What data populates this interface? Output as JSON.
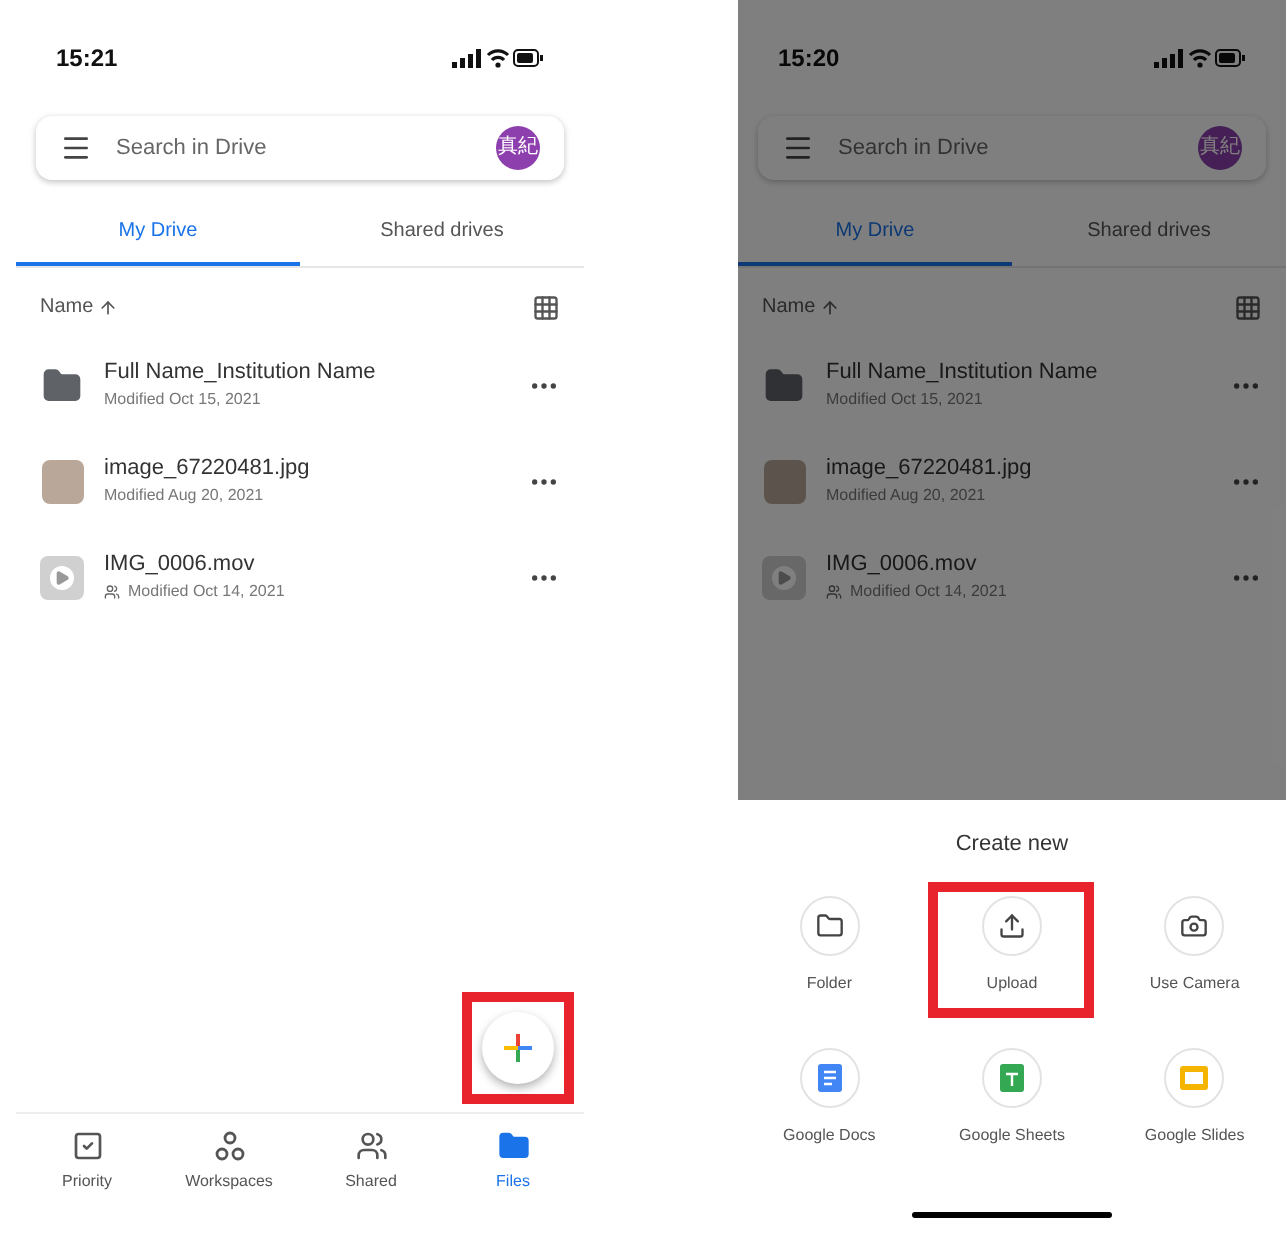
{
  "screens": [
    {
      "dimmed": false,
      "status_bar": {
        "time": "15:21"
      },
      "search": {
        "placeholder": "Search in Drive",
        "avatar": "真紀"
      },
      "tabs": [
        {
          "label": "My Drive",
          "selected": true
        },
        {
          "label": "Shared drives",
          "selected": false
        }
      ],
      "sort": {
        "label": "Name"
      },
      "files": [
        {
          "kind": "folder",
          "name": "Full Name_Institution Name",
          "modified": "Modified Oct 15, 2021",
          "shared": false
        },
        {
          "kind": "image",
          "name": "image_67220481.jpg",
          "modified": "Modified Aug 20, 2021",
          "shared": false
        },
        {
          "kind": "video",
          "name": "IMG_0006.mov",
          "modified": "Modified Oct 14, 2021",
          "shared": true
        }
      ],
      "fab": {
        "highlighted": true
      },
      "bottom_nav": [
        {
          "kind": "priority",
          "label": "Priority",
          "selected": false
        },
        {
          "kind": "workspaces",
          "label": "Workspaces",
          "selected": false
        },
        {
          "kind": "shared",
          "label": "Shared",
          "selected": false
        },
        {
          "kind": "files",
          "label": "Files",
          "selected": true
        }
      ]
    },
    {
      "dimmed": true,
      "status_bar": {
        "time": "15:20"
      },
      "search": {
        "placeholder": "Search in Drive",
        "avatar": "真紀"
      },
      "tabs": [
        {
          "label": "My Drive",
          "selected": true
        },
        {
          "label": "Shared drives",
          "selected": false
        }
      ],
      "sort": {
        "label": "Name"
      },
      "files": [
        {
          "kind": "folder",
          "name": "Full Name_Institution Name",
          "modified": "Modified Oct 15, 2021",
          "shared": false
        },
        {
          "kind": "image",
          "name": "image_67220481.jpg",
          "modified": "Modified Aug 20, 2021",
          "shared": false
        },
        {
          "kind": "video",
          "name": "IMG_0006.mov",
          "modified": "Modified Oct 14, 2021",
          "shared": true
        }
      ],
      "create_sheet": {
        "title": "Create new",
        "items": [
          {
            "kind": "folder",
            "label": "Folder",
            "highlighted": false
          },
          {
            "kind": "upload",
            "label": "Upload",
            "highlighted": true
          },
          {
            "kind": "camera",
            "label": "Use Camera",
            "highlighted": false
          },
          {
            "kind": "docs",
            "label": "Google Docs",
            "highlighted": false
          },
          {
            "kind": "sheets",
            "label": "Google Sheets",
            "highlighted": false
          },
          {
            "kind": "slides",
            "label": "Google Slides",
            "highlighted": false
          }
        ]
      }
    }
  ]
}
